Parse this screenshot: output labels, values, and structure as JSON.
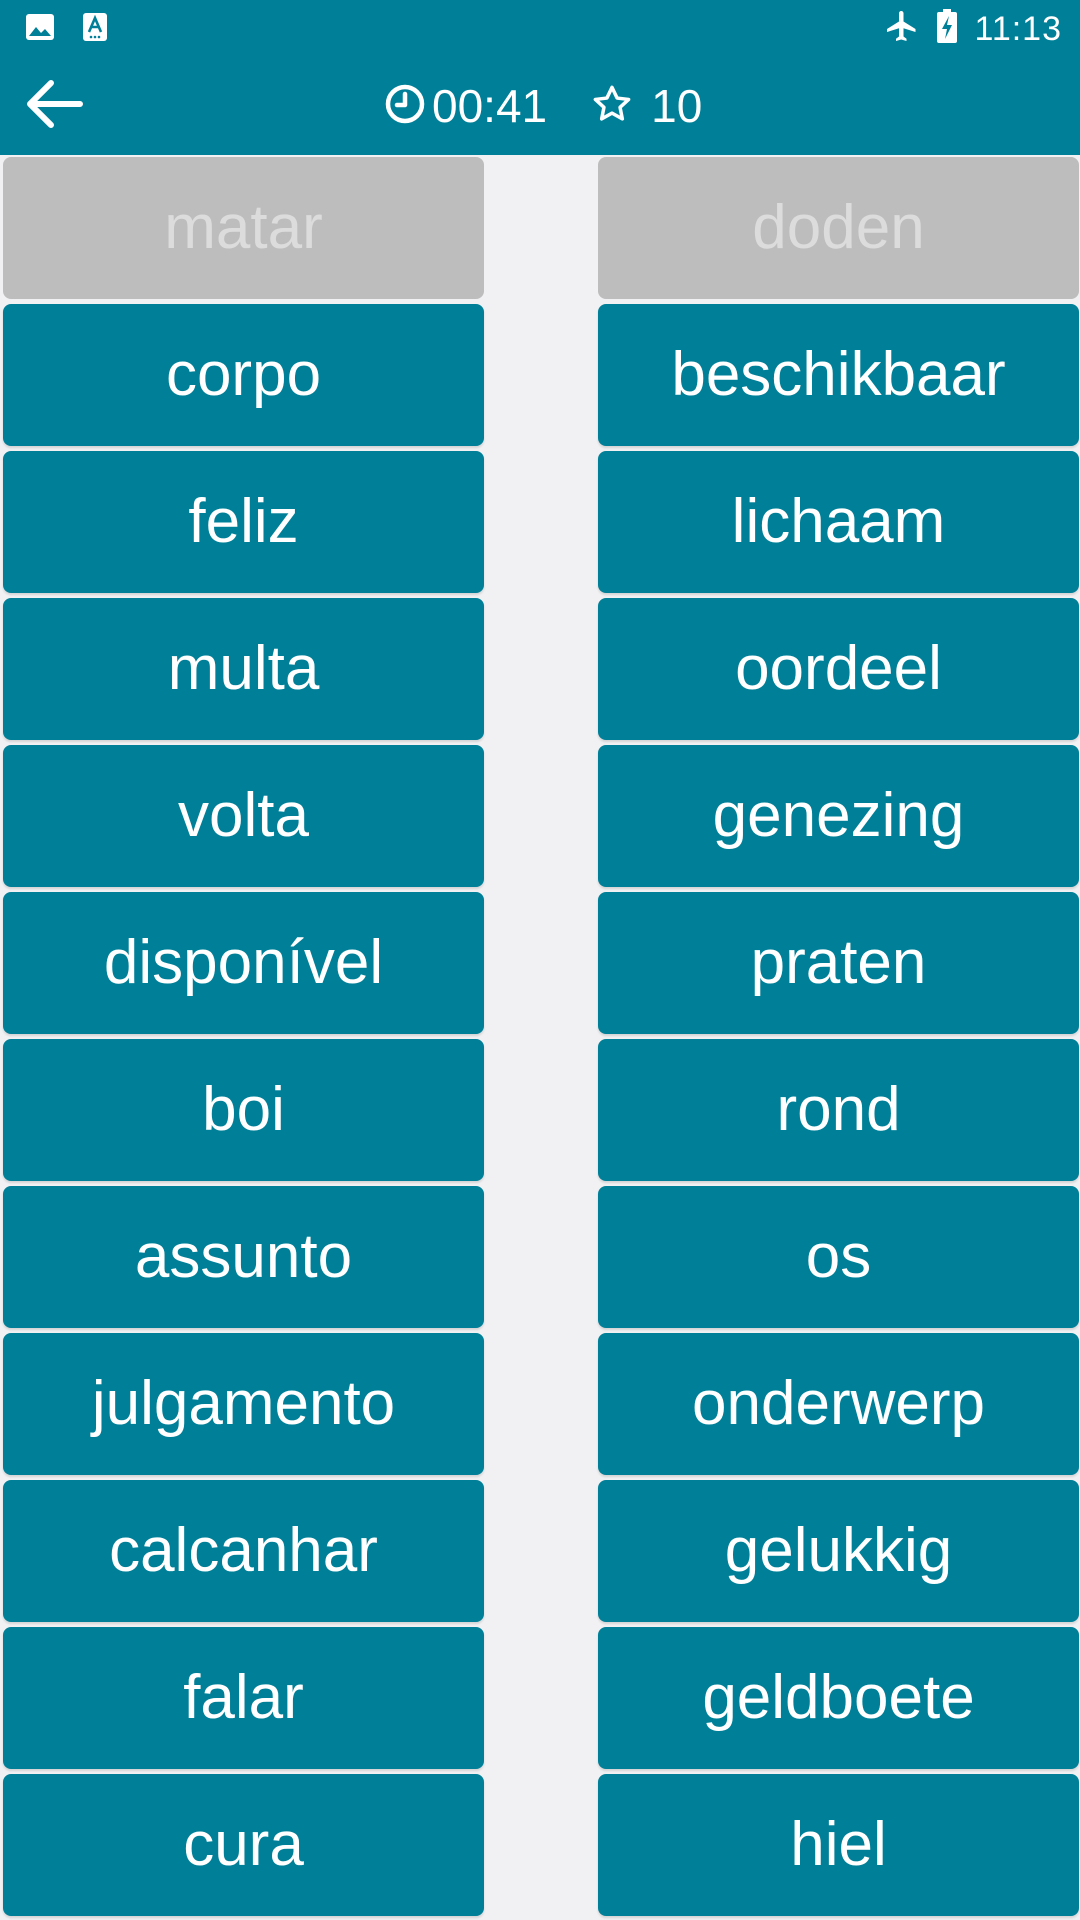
{
  "status_bar": {
    "time": "11:13",
    "icons": [
      "image-icon",
      "translate-a-icon",
      "airplane-mode-icon",
      "battery-charging-icon"
    ]
  },
  "header": {
    "back_icon": "arrow-left-icon",
    "timer_icon": "clock-icon",
    "timer": "00:41",
    "score_icon": "star-outline-icon",
    "score": "10"
  },
  "colors": {
    "primary": "#008098",
    "tile_matched": "#bdbdbd",
    "tile_matched_text": "#dcdcdc",
    "background": "#f1f1f3"
  },
  "board": {
    "left": [
      {
        "label": "matar",
        "state": "matched"
      },
      {
        "label": "corpo",
        "state": "active"
      },
      {
        "label": "feliz",
        "state": "active"
      },
      {
        "label": "multa",
        "state": "active"
      },
      {
        "label": "volta",
        "state": "active"
      },
      {
        "label": "disponível",
        "state": "active"
      },
      {
        "label": "boi",
        "state": "active"
      },
      {
        "label": "assunto",
        "state": "active"
      },
      {
        "label": "julgamento",
        "state": "active"
      },
      {
        "label": "calcanhar",
        "state": "active"
      },
      {
        "label": "falar",
        "state": "active"
      },
      {
        "label": "cura",
        "state": "active"
      }
    ],
    "right": [
      {
        "label": "doden",
        "state": "matched"
      },
      {
        "label": "beschikbaar",
        "state": "active"
      },
      {
        "label": "lichaam",
        "state": "active"
      },
      {
        "label": "oordeel",
        "state": "active"
      },
      {
        "label": "genezing",
        "state": "active"
      },
      {
        "label": "praten",
        "state": "active"
      },
      {
        "label": "rond",
        "state": "active"
      },
      {
        "label": "os",
        "state": "active"
      },
      {
        "label": "onderwerp",
        "state": "active"
      },
      {
        "label": "gelukkig",
        "state": "active"
      },
      {
        "label": "geldboete",
        "state": "active"
      },
      {
        "label": "hiel",
        "state": "active"
      }
    ]
  }
}
